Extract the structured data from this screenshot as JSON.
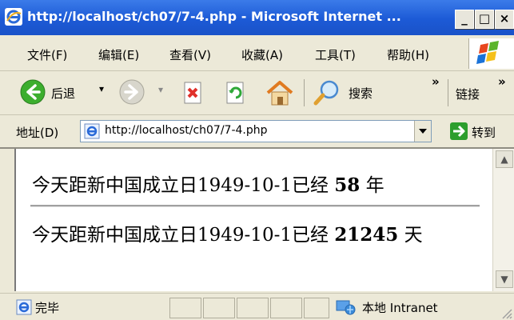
{
  "window": {
    "title": "http://localhost/ch07/7-4.php - Microsoft Internet ...",
    "controls": {
      "minimize": "_",
      "maximize": "□",
      "close": "×"
    }
  },
  "menu": {
    "items": [
      "文件(F)",
      "编辑(E)",
      "查看(V)",
      "收藏(A)",
      "工具(T)",
      "帮助(H)"
    ]
  },
  "toolbar": {
    "back_label": "后退",
    "search_label": "搜索",
    "links_label": "链接",
    "chevron": "»"
  },
  "address": {
    "label": "地址(D)",
    "value": "http://localhost/ch07/7-4.php",
    "go_label": "转到"
  },
  "content": {
    "line1": {
      "prefix": "今天距新中国成立日",
      "date": "1949-10-1",
      "mid": "已经",
      "value": "58",
      "unit": "年"
    },
    "line2": {
      "prefix": "今天距新中国成立日",
      "date": "1949-10-1",
      "mid": "已经",
      "value": "21245",
      "unit": "天"
    }
  },
  "status": {
    "text": "完毕",
    "zone": "本地 Intranet"
  },
  "colors": {
    "titlebar": "#1c5ad6",
    "chrome": "#ece9d8",
    "back_icon": "#3cae2e",
    "go_icon": "#2d9e2d"
  },
  "icons": [
    "ie-page-icon",
    "windows-logo-icon",
    "back-icon",
    "forward-icon",
    "stop-icon",
    "refresh-icon",
    "home-icon",
    "search-icon",
    "go-icon",
    "status-page-icon",
    "intranet-icon"
  ]
}
